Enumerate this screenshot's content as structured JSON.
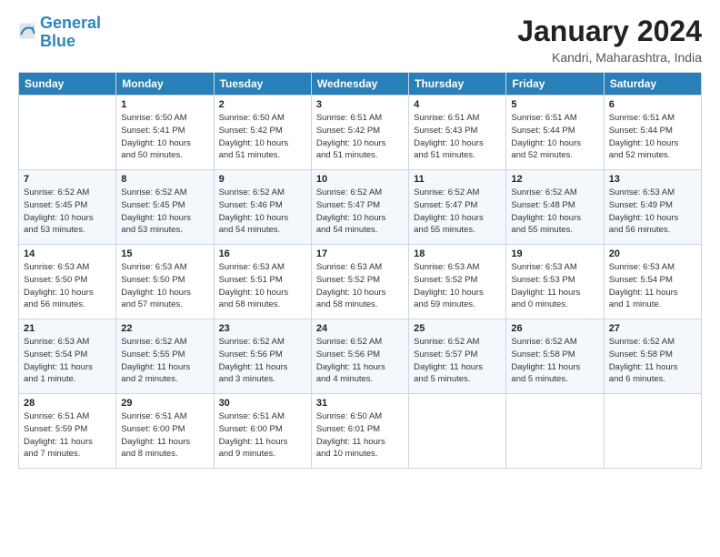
{
  "header": {
    "logo_line1": "General",
    "logo_line2": "Blue",
    "title": "January 2024",
    "subtitle": "Kandri, Maharashtra, India"
  },
  "weekdays": [
    "Sunday",
    "Monday",
    "Tuesday",
    "Wednesday",
    "Thursday",
    "Friday",
    "Saturday"
  ],
  "weeks": [
    [
      {
        "num": "",
        "info": ""
      },
      {
        "num": "1",
        "info": "Sunrise: 6:50 AM\nSunset: 5:41 PM\nDaylight: 10 hours\nand 50 minutes."
      },
      {
        "num": "2",
        "info": "Sunrise: 6:50 AM\nSunset: 5:42 PM\nDaylight: 10 hours\nand 51 minutes."
      },
      {
        "num": "3",
        "info": "Sunrise: 6:51 AM\nSunset: 5:42 PM\nDaylight: 10 hours\nand 51 minutes."
      },
      {
        "num": "4",
        "info": "Sunrise: 6:51 AM\nSunset: 5:43 PM\nDaylight: 10 hours\nand 51 minutes."
      },
      {
        "num": "5",
        "info": "Sunrise: 6:51 AM\nSunset: 5:44 PM\nDaylight: 10 hours\nand 52 minutes."
      },
      {
        "num": "6",
        "info": "Sunrise: 6:51 AM\nSunset: 5:44 PM\nDaylight: 10 hours\nand 52 minutes."
      }
    ],
    [
      {
        "num": "7",
        "info": "Sunrise: 6:52 AM\nSunset: 5:45 PM\nDaylight: 10 hours\nand 53 minutes."
      },
      {
        "num": "8",
        "info": "Sunrise: 6:52 AM\nSunset: 5:45 PM\nDaylight: 10 hours\nand 53 minutes."
      },
      {
        "num": "9",
        "info": "Sunrise: 6:52 AM\nSunset: 5:46 PM\nDaylight: 10 hours\nand 54 minutes."
      },
      {
        "num": "10",
        "info": "Sunrise: 6:52 AM\nSunset: 5:47 PM\nDaylight: 10 hours\nand 54 minutes."
      },
      {
        "num": "11",
        "info": "Sunrise: 6:52 AM\nSunset: 5:47 PM\nDaylight: 10 hours\nand 55 minutes."
      },
      {
        "num": "12",
        "info": "Sunrise: 6:52 AM\nSunset: 5:48 PM\nDaylight: 10 hours\nand 55 minutes."
      },
      {
        "num": "13",
        "info": "Sunrise: 6:53 AM\nSunset: 5:49 PM\nDaylight: 10 hours\nand 56 minutes."
      }
    ],
    [
      {
        "num": "14",
        "info": "Sunrise: 6:53 AM\nSunset: 5:50 PM\nDaylight: 10 hours\nand 56 minutes."
      },
      {
        "num": "15",
        "info": "Sunrise: 6:53 AM\nSunset: 5:50 PM\nDaylight: 10 hours\nand 57 minutes."
      },
      {
        "num": "16",
        "info": "Sunrise: 6:53 AM\nSunset: 5:51 PM\nDaylight: 10 hours\nand 58 minutes."
      },
      {
        "num": "17",
        "info": "Sunrise: 6:53 AM\nSunset: 5:52 PM\nDaylight: 10 hours\nand 58 minutes."
      },
      {
        "num": "18",
        "info": "Sunrise: 6:53 AM\nSunset: 5:52 PM\nDaylight: 10 hours\nand 59 minutes."
      },
      {
        "num": "19",
        "info": "Sunrise: 6:53 AM\nSunset: 5:53 PM\nDaylight: 11 hours\nand 0 minutes."
      },
      {
        "num": "20",
        "info": "Sunrise: 6:53 AM\nSunset: 5:54 PM\nDaylight: 11 hours\nand 1 minute."
      }
    ],
    [
      {
        "num": "21",
        "info": "Sunrise: 6:53 AM\nSunset: 5:54 PM\nDaylight: 11 hours\nand 1 minute."
      },
      {
        "num": "22",
        "info": "Sunrise: 6:52 AM\nSunset: 5:55 PM\nDaylight: 11 hours\nand 2 minutes."
      },
      {
        "num": "23",
        "info": "Sunrise: 6:52 AM\nSunset: 5:56 PM\nDaylight: 11 hours\nand 3 minutes."
      },
      {
        "num": "24",
        "info": "Sunrise: 6:52 AM\nSunset: 5:56 PM\nDaylight: 11 hours\nand 4 minutes."
      },
      {
        "num": "25",
        "info": "Sunrise: 6:52 AM\nSunset: 5:57 PM\nDaylight: 11 hours\nand 5 minutes."
      },
      {
        "num": "26",
        "info": "Sunrise: 6:52 AM\nSunset: 5:58 PM\nDaylight: 11 hours\nand 5 minutes."
      },
      {
        "num": "27",
        "info": "Sunrise: 6:52 AM\nSunset: 5:58 PM\nDaylight: 11 hours\nand 6 minutes."
      }
    ],
    [
      {
        "num": "28",
        "info": "Sunrise: 6:51 AM\nSunset: 5:59 PM\nDaylight: 11 hours\nand 7 minutes."
      },
      {
        "num": "29",
        "info": "Sunrise: 6:51 AM\nSunset: 6:00 PM\nDaylight: 11 hours\nand 8 minutes."
      },
      {
        "num": "30",
        "info": "Sunrise: 6:51 AM\nSunset: 6:00 PM\nDaylight: 11 hours\nand 9 minutes."
      },
      {
        "num": "31",
        "info": "Sunrise: 6:50 AM\nSunset: 6:01 PM\nDaylight: 11 hours\nand 10 minutes."
      },
      {
        "num": "",
        "info": ""
      },
      {
        "num": "",
        "info": ""
      },
      {
        "num": "",
        "info": ""
      }
    ]
  ]
}
